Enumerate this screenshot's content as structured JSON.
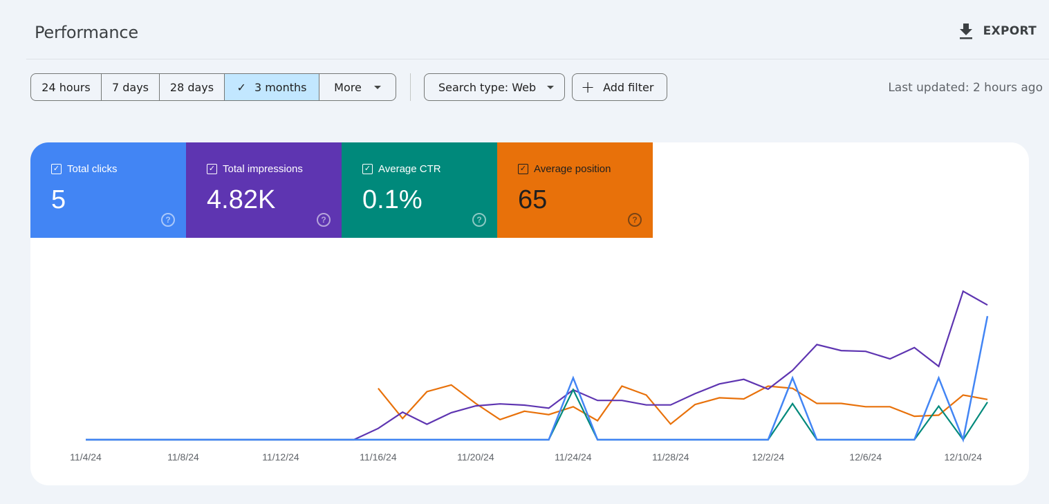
{
  "header": {
    "title": "Performance",
    "export_label": "EXPORT"
  },
  "filters": {
    "date_ranges": [
      {
        "label": "24 hours",
        "active": false
      },
      {
        "label": "7 days",
        "active": false
      },
      {
        "label": "28 days",
        "active": false
      },
      {
        "label": "3 months",
        "active": true
      },
      {
        "label": "More",
        "active": false
      }
    ],
    "search_type": "Search type: Web",
    "add_filter": "Add filter",
    "last_updated": "Last updated: 2 hours ago"
  },
  "metrics": [
    {
      "label": "Total clicks",
      "value": "5",
      "color": "#4285f4",
      "text_color": "#ffffff",
      "checked": true
    },
    {
      "label": "Total impressions",
      "value": "4.82K",
      "color": "#5e35b1",
      "text_color": "#ffffff",
      "checked": true
    },
    {
      "label": "Average CTR",
      "value": "0.1%",
      "color": "#00897b",
      "text_color": "#ffffff",
      "checked": true
    },
    {
      "label": "Average position",
      "value": "65",
      "color": "#e8710a",
      "text_color": "#1f1f1f",
      "checked": true
    }
  ],
  "chart_data": {
    "type": "line",
    "title": "",
    "x": [
      "11/4/24",
      "11/5/24",
      "11/6/24",
      "11/7/24",
      "11/8/24",
      "11/9/24",
      "11/10/24",
      "11/11/24",
      "11/12/24",
      "11/13/24",
      "11/14/24",
      "11/15/24",
      "11/16/24",
      "11/17/24",
      "11/18/24",
      "11/19/24",
      "11/20/24",
      "11/21/24",
      "11/22/24",
      "11/23/24",
      "11/24/24",
      "11/25/24",
      "11/26/24",
      "11/27/24",
      "11/28/24",
      "11/29/24",
      "11/30/24",
      "12/1/24",
      "12/2/24",
      "12/3/24",
      "12/4/24",
      "12/5/24",
      "12/6/24",
      "12/7/24",
      "12/8/24",
      "12/9/24",
      "12/10/24",
      "12/11/24"
    ],
    "x_tick_labels": [
      "11/4/24",
      "11/8/24",
      "11/12/24",
      "11/16/24",
      "11/20/24",
      "11/24/24",
      "11/28/24",
      "12/2/24",
      "12/6/24",
      "12/10/24"
    ],
    "grid": false,
    "legend": "metric tiles (top)",
    "series": [
      {
        "name": "Total clicks",
        "color": "#4285f4",
        "ymax": 2.35,
        "values": [
          0,
          0,
          0,
          0,
          0,
          0,
          0,
          0,
          0,
          0,
          0,
          0,
          0,
          0,
          0,
          0,
          0,
          0,
          0,
          0,
          1,
          0,
          0,
          0,
          0,
          0,
          0,
          0,
          0,
          1,
          0,
          0,
          0,
          0,
          0,
          1,
          0,
          2
        ]
      },
      {
        "name": "Total impressions",
        "color": "#5e35b1",
        "ymax": 580,
        "values": [
          0,
          0,
          0,
          0,
          0,
          0,
          0,
          0,
          0,
          0,
          0,
          0,
          45,
          110,
          62,
          108,
          135,
          143,
          138,
          126,
          199,
          157,
          157,
          139,
          139,
          184,
          223,
          241,
          202,
          277,
          380,
          356,
          353,
          323,
          368,
          293,
          593,
          538
        ]
      },
      {
        "name": "Average CTR",
        "color": "#00897b",
        "unit": "%",
        "ymax": 2.9,
        "values": [
          0,
          0,
          0,
          0,
          0,
          0,
          0,
          0,
          0,
          0,
          0,
          0,
          0,
          0,
          0,
          0,
          0,
          0,
          0,
          0,
          1.0,
          0,
          0,
          0,
          0,
          0,
          0,
          0,
          0,
          0.72,
          0,
          0,
          0,
          0,
          0,
          0.67,
          0,
          0.75
        ]
      },
      {
        "name": "Average position",
        "color": "#e8710a",
        "ymax": 260,
        "values": [
          null,
          null,
          null,
          null,
          null,
          null,
          null,
          null,
          null,
          null,
          null,
          null,
          92,
          38,
          86,
          98,
          65,
          36,
          51,
          45,
          59,
          34,
          96,
          80,
          28,
          63,
          75,
          73,
          96,
          92,
          65,
          65,
          59,
          59,
          42,
          44,
          80,
          72
        ]
      }
    ]
  }
}
